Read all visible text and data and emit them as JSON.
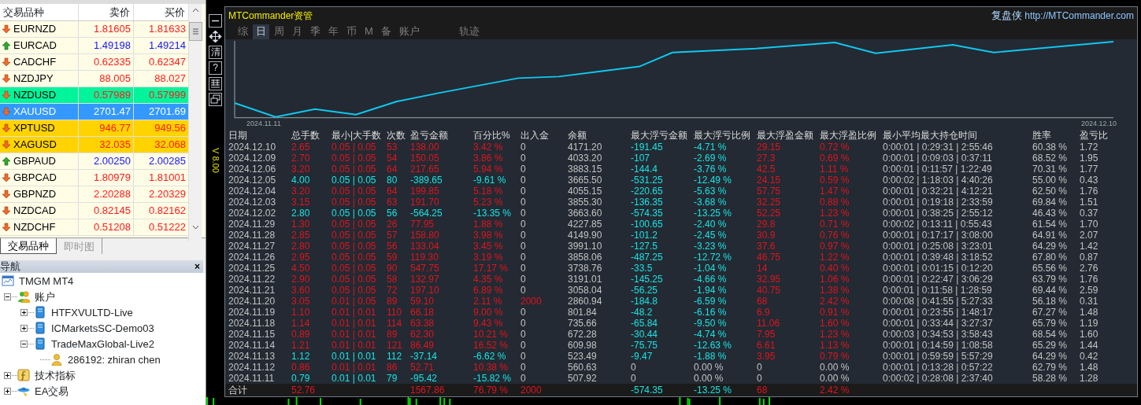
{
  "market_watch": {
    "columns": [
      "交易品种",
      "卖价",
      "买价"
    ],
    "rows": [
      {
        "symbol": "EURNZD",
        "rising": false,
        "bid": "1.81605",
        "ask": "1.81633",
        "color": "#fffde6",
        "selected": false
      },
      {
        "symbol": "EURCAD",
        "rising": true,
        "bid": "1.49198",
        "ask": "1.49214",
        "color": "#fffde6",
        "selected": false
      },
      {
        "symbol": "CADCHF",
        "rising": false,
        "bid": "0.62335",
        "ask": "0.62347",
        "color": "#fffde6",
        "selected": false
      },
      {
        "symbol": "NZDJPY",
        "rising": false,
        "bid": "88.005",
        "ask": "88.027",
        "color": "#fffde6",
        "selected": false
      },
      {
        "symbol": "NZDUSD",
        "rising": false,
        "bid": "0.57989",
        "ask": "0.57999",
        "color": "#00f59b",
        "selected": false
      },
      {
        "symbol": "XAUUSD",
        "rising": false,
        "bid": "2701.47",
        "ask": "2701.69",
        "color": "#3399ff",
        "selected": true
      },
      {
        "symbol": "XPTUSD",
        "rising": false,
        "bid": "946.77",
        "ask": "949.56",
        "color": "#ffd300",
        "selected": false
      },
      {
        "symbol": "XAGUSD",
        "rising": false,
        "bid": "32.035",
        "ask": "32.068",
        "color": "#ffd300",
        "selected": false
      },
      {
        "symbol": "GBPAUD",
        "rising": true,
        "bid": "2.00250",
        "ask": "2.00285",
        "color": "#fffde6",
        "selected": false
      },
      {
        "symbol": "GBPCAD",
        "rising": false,
        "bid": "1.80979",
        "ask": "1.81001",
        "color": "#fffde6",
        "selected": false
      },
      {
        "symbol": "GBPNZD",
        "rising": false,
        "bid": "2.20288",
        "ask": "2.20329",
        "color": "#fffde6",
        "selected": false
      },
      {
        "symbol": "NZDCAD",
        "rising": false,
        "bid": "0.82145",
        "ask": "0.82162",
        "color": "#fffde6",
        "selected": false
      },
      {
        "symbol": "NZDCHF",
        "rising": false,
        "bid": "0.51208",
        "ask": "0.51222",
        "color": "#fffde6",
        "selected": false
      }
    ],
    "tabs": [
      {
        "label": "交易品种",
        "selected": true
      },
      {
        "label": "即时图",
        "selected": false
      }
    ]
  },
  "navigator": {
    "title": "导航",
    "close": "×",
    "tree": [
      {
        "label": "TMGM MT4",
        "kind": "terminal",
        "children": [
          {
            "label": "账户",
            "kind": "accounts",
            "expanded": true,
            "children": [
              {
                "label": "HTFXVULTD-Live",
                "kind": "server",
                "expanded": false
              },
              {
                "label": "ICMarketsSC-Demo03",
                "kind": "server",
                "expanded": false
              },
              {
                "label": "TradeMaxGlobal-Live2",
                "kind": "server",
                "expanded": true,
                "children": [
                  {
                    "label": "286192: zhiran chen",
                    "kind": "user"
                  }
                ]
              }
            ]
          },
          {
            "label": "技术指标",
            "kind": "indicator",
            "expanded": false
          },
          {
            "label": "EA交易",
            "kind": "expert",
            "expanded": false
          }
        ]
      }
    ]
  },
  "toolbar": [
    {
      "kind": "minimize"
    },
    {
      "kind": "move"
    },
    {
      "kind": "text",
      "label": "清"
    },
    {
      "kind": "text",
      "label": "?"
    },
    {
      "kind": "grid"
    },
    {
      "kind": "restore"
    }
  ],
  "version": "V 8.00",
  "panel": {
    "title": "MTCommander资管",
    "brand": "复盘侠",
    "url": "http://MTCommander.com",
    "tabs": [
      {
        "label": "综",
        "selected": false
      },
      {
        "label": "日",
        "selected": true
      },
      {
        "label": "周",
        "selected": false
      },
      {
        "label": "月",
        "selected": false
      },
      {
        "label": "季",
        "selected": false
      },
      {
        "label": "年",
        "selected": false
      },
      {
        "label": "币",
        "selected": false
      },
      {
        "label": "M",
        "selected": false
      },
      {
        "label": "备",
        "selected": false
      },
      {
        "label": "账户",
        "selected": false
      },
      {
        "label": "轨迹",
        "selected": false
      }
    ],
    "chart": {
      "start_label": "2024.11.11",
      "end_label": "2024.12.10"
    },
    "columns": [
      {
        "label": "日期",
        "kind": "plain"
      },
      {
        "label": "总手数",
        "kind": "result"
      },
      {
        "label": "最小|大手数",
        "kind": "result"
      },
      {
        "label": "次数",
        "kind": "result"
      },
      {
        "label": "盈亏金额",
        "kind": "result"
      },
      {
        "label": "百分比%",
        "kind": "result"
      },
      {
        "label": "出入金",
        "kind": "deposit"
      },
      {
        "label": "余额",
        "kind": "plain"
      },
      {
        "label": "最大浮亏金额",
        "kind": "float_loss"
      },
      {
        "label": "最大浮亏比例",
        "kind": "float_loss"
      },
      {
        "label": "最大浮盈金额",
        "kind": "float_gain"
      },
      {
        "label": "最大浮盈比例",
        "kind": "float_gain"
      },
      {
        "label": "最小平均最大持仓时间",
        "kind": "plain"
      },
      {
        "label": "胜率",
        "kind": "plain"
      },
      {
        "label": "盈亏比",
        "kind": "plain"
      }
    ],
    "rows": [
      {
        "profit": true,
        "deposit_made": false,
        "float_flat": false,
        "cells": [
          "2024.12.10",
          "2.65",
          "0.05 | 0.05",
          "53",
          "138.00",
          "3.42 %",
          "0",
          "4171.20",
          "-191.45",
          "-4.71 %",
          "29.15",
          "0.72 %",
          "0:00:01 | 0:29:31 | 2:55:46",
          "60.38 %",
          "1.72"
        ]
      },
      {
        "profit": true,
        "deposit_made": false,
        "float_flat": false,
        "cells": [
          "2024.12.09",
          "2.70",
          "0.05 | 0.05",
          "54",
          "150.05",
          "3.86 %",
          "0",
          "4033.20",
          "-107",
          "-2.69 %",
          "27.3",
          "0.69 %",
          "0:00:01 | 0:09:03 | 0:37:11",
          "68.52 %",
          "1.95"
        ]
      },
      {
        "profit": true,
        "deposit_made": false,
        "float_flat": false,
        "cells": [
          "2024.12.06",
          "3.20",
          "0.05 | 0.05",
          "64",
          "217.65",
          "5.94 %",
          "0",
          "3883.15",
          "-144.4",
          "-3.76 %",
          "42.5",
          "1.11 %",
          "0:00:01 | 0:11:57 | 1:22:49",
          "70.31 %",
          "1.77"
        ]
      },
      {
        "profit": false,
        "deposit_made": false,
        "float_flat": false,
        "cells": [
          "2024.12.05",
          "4.00",
          "0.05 | 0.05",
          "80",
          "-389.65",
          "-9.61 %",
          "0",
          "3665.50",
          "-531.25",
          "-12.49 %",
          "24.15",
          "0.59 %",
          "0:00:02 | 1:18:03 | 4:40:26",
          "55.00 %",
          "0.43"
        ]
      },
      {
        "profit": true,
        "deposit_made": false,
        "float_flat": false,
        "cells": [
          "2024.12.04",
          "3.20",
          "0.05 | 0.05",
          "64",
          "199.85",
          "5.18 %",
          "0",
          "4055.15",
          "-220.65",
          "-5.63 %",
          "57.75",
          "1.47 %",
          "0:00:01 | 0:32:21 | 4:12:21",
          "62.50 %",
          "1.76"
        ]
      },
      {
        "profit": true,
        "deposit_made": false,
        "float_flat": false,
        "cells": [
          "2024.12.03",
          "3.15",
          "0.05 | 0.05",
          "63",
          "191.70",
          "5.23 %",
          "0",
          "3855.30",
          "-136.35",
          "-3.68 %",
          "32.25",
          "0.88 %",
          "0:00:01 | 0:19:18 | 2:33:59",
          "69.84 %",
          "1.51"
        ]
      },
      {
        "profit": false,
        "deposit_made": false,
        "float_flat": false,
        "cells": [
          "2024.12.02",
          "2.80",
          "0.05 | 0.05",
          "56",
          "-564.25",
          "-13.35 %",
          "0",
          "3663.60",
          "-574.35",
          "-13.25 %",
          "52.25",
          "1.23 %",
          "0:00:01 | 0:38:25 | 2:55:12",
          "46.43 %",
          "0.37"
        ]
      },
      {
        "profit": true,
        "deposit_made": false,
        "float_flat": false,
        "cells": [
          "2024.11.29",
          "1.30",
          "0.05 | 0.05",
          "26",
          "77.95",
          "1.88 %",
          "0",
          "4227.85",
          "-100.65",
          "-2.40 %",
          "29.8",
          "0.71 %",
          "0:00:02 | 0:13:11 | 0:55:43",
          "61.54 %",
          "1.70"
        ]
      },
      {
        "profit": true,
        "deposit_made": false,
        "float_flat": false,
        "cells": [
          "2024.11.28",
          "2.85",
          "0.05 | 0.05",
          "57",
          "158.80",
          "3.98 %",
          "0",
          "4149.90",
          "-101.2",
          "-2.45 %",
          "30.9",
          "0.76 %",
          "0:00:01 | 0:17:17 | 3:08:00",
          "64.91 %",
          "2.07"
        ]
      },
      {
        "profit": true,
        "deposit_made": false,
        "float_flat": false,
        "cells": [
          "2024.11.27",
          "2.80",
          "0.05 | 0.05",
          "56",
          "133.04",
          "3.45 %",
          "0",
          "3991.10",
          "-127.5",
          "-3.23 %",
          "37.6",
          "0.97 %",
          "0:00:01 | 0:25:08 | 3:23:01",
          "64.29 %",
          "1.42"
        ]
      },
      {
        "profit": true,
        "deposit_made": false,
        "float_flat": false,
        "cells": [
          "2024.11.26",
          "2.95",
          "0.05 | 0.05",
          "59",
          "119.30",
          "3.19 %",
          "0",
          "3858.06",
          "-487.25",
          "-12.72 %",
          "46.75",
          "1.22 %",
          "0:00:01 | 0:39:48 | 3:18:52",
          "67.80 %",
          "0.87"
        ]
      },
      {
        "profit": true,
        "deposit_made": false,
        "float_flat": false,
        "cells": [
          "2024.11.25",
          "4.50",
          "0.05 | 0.05",
          "90",
          "547.75",
          "17.17 %",
          "0",
          "3738.76",
          "-33.5",
          "-1.04 %",
          "14",
          "0.40 %",
          "0:00:01 | 0:01:15 | 0:12:20",
          "65.56 %",
          "2.76"
        ]
      },
      {
        "profit": true,
        "deposit_made": false,
        "float_flat": false,
        "cells": [
          "2024.11.22",
          "2.90",
          "0.05 | 0.05",
          "58",
          "132.97",
          "4.35 %",
          "0",
          "3191.01",
          "-145.25",
          "-4.66 %",
          "32.95",
          "1.06 %",
          "0:00:01 | 0:22:47 | 3:06:29",
          "63.79 %",
          "1.76"
        ]
      },
      {
        "profit": true,
        "deposit_made": false,
        "float_flat": false,
        "cells": [
          "2024.11.21",
          "3.60",
          "0.05 | 0.05",
          "72",
          "197.10",
          "6.89 %",
          "0",
          "3058.04",
          "-56.25",
          "-1.94 %",
          "40.75",
          "1.38 %",
          "0:00:01 | 0:11:58 | 1:28:59",
          "69.44 %",
          "2.59"
        ]
      },
      {
        "profit": true,
        "deposit_made": true,
        "float_flat": false,
        "cells": [
          "2024.11.20",
          "3.05",
          "0.01 | 0.05",
          "89",
          "59.10",
          "2.11 %",
          "2000",
          "2860.94",
          "-184.8",
          "-6.59 %",
          "68",
          "2.42 %",
          "0:00:08 | 0:41:55 | 5:27:33",
          "56.18 %",
          "0.31"
        ]
      },
      {
        "profit": true,
        "deposit_made": false,
        "float_flat": false,
        "cells": [
          "2024.11.19",
          "1.10",
          "0.01 | 0.01",
          "110",
          "66.18",
          "9.00 %",
          "0",
          "801.84",
          "-48.2",
          "-6.16 %",
          "6.9",
          "0.91 %",
          "0:00:01 | 0:23:55 | 1:48:17",
          "67.27 %",
          "1.48"
        ]
      },
      {
        "profit": true,
        "deposit_made": false,
        "float_flat": false,
        "cells": [
          "2024.11.18",
          "1.14",
          "0.01 | 0.01",
          "114",
          "63.38",
          "9.43 %",
          "0",
          "735.66",
          "-65.84",
          "-9.50 %",
          "11.06",
          "1.60 %",
          "0:00:01 | 0:33:44 | 3:27:37",
          "65.79 %",
          "1.19"
        ]
      },
      {
        "profit": true,
        "deposit_made": false,
        "float_flat": false,
        "cells": [
          "2024.11.15",
          "0.89",
          "0.01 | 0.01",
          "89",
          "62.30",
          "10.21 %",
          "0",
          "672.28",
          "-30.44",
          "-4.74 %",
          "7.95",
          "1.23 %",
          "0:00:03 | 0:34:53 | 3:58:43",
          "68.54 %",
          "1.60"
        ]
      },
      {
        "profit": true,
        "deposit_made": false,
        "float_flat": false,
        "cells": [
          "2024.11.14",
          "1.21",
          "0.01 | 0.01",
          "121",
          "86.49",
          "16.52 %",
          "0",
          "609.98",
          "-75.75",
          "-12.63 %",
          "6.61",
          "1.13 %",
          "0:00:01 | 0:14:59 | 1:08:58",
          "65.29 %",
          "1.44"
        ]
      },
      {
        "profit": false,
        "deposit_made": false,
        "float_flat": false,
        "cells": [
          "2024.11.13",
          "1.12",
          "0.01 | 0.01",
          "112",
          "-37.14",
          "-6.62 %",
          "0",
          "523.49",
          "-9.47",
          "-1.88 %",
          "3.95",
          "0.79 %",
          "0:00:01 | 0:59:59 | 5:57:29",
          "64.29 %",
          "0.42"
        ]
      },
      {
        "profit": true,
        "deposit_made": false,
        "float_flat": true,
        "cells": [
          "2024.11.12",
          "0.86",
          "0.01 | 0.01",
          "86",
          "52.71",
          "10.38 %",
          "0",
          "560.63",
          "0",
          "0.00 %",
          "0",
          "0.00 %",
          "0:00:01 | 0:13:28 | 0:57:22",
          "62.79 %",
          "1.48"
        ]
      },
      {
        "profit": false,
        "deposit_made": false,
        "float_flat": true,
        "cells": [
          "2024.11.11",
          "0.79",
          "0.01 | 0.01",
          "79",
          "-95.42",
          "-15.82 %",
          "0",
          "507.92",
          "0",
          "0.00 %",
          "0",
          "0.00 %",
          "0:00:02 | 0:28:08 | 2:37:40",
          "58.28 %",
          "1.28"
        ]
      }
    ],
    "total": {
      "label": "合计",
      "lots": "52.76",
      "pnl": "1567.86",
      "pct": "76.79 %",
      "deposit": "2000",
      "max_float_loss": "-574.35",
      "max_float_loss_pct": "-13.25 %",
      "max_float_gain": "68",
      "max_float_gain_pct": "2.42 %"
    }
  }
}
